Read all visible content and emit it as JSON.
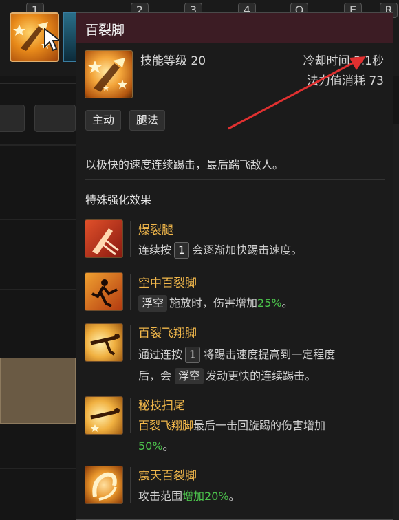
{
  "hotbar": {
    "keys": [
      "1",
      "2",
      "3",
      "4",
      "Q",
      "E",
      "R"
    ]
  },
  "tooltip": {
    "title": "百裂脚",
    "skill_level": "技能等级 20",
    "cooldown": "冷却时间 3.1秒",
    "mana_cost": "法力值消耗 73",
    "tags": [
      "主动",
      "腿法"
    ],
    "description": "以极快的速度连续踢击，最后踹飞敌人。",
    "special_title": "特殊强化效果",
    "effects": [
      {
        "name": "爆裂腿",
        "line1_pre": "连续按",
        "line1_key": "1",
        "line1_post": "会逐渐加快踢击速度。"
      },
      {
        "name": "空中百裂脚",
        "line1_chip": "浮空",
        "line1_mid": "施放时，伤害增加",
        "line1_value": "25%",
        "line1_end": "。"
      },
      {
        "name": "百裂飞翔脚",
        "line1_pre": "通过连按",
        "line1_key": "1",
        "line1_post": "将踢击速度提高到一定程度",
        "line2_pre": "后，会",
        "line2_chip": "浮空",
        "line2_post": "发动更快的连续踢击。"
      },
      {
        "name": "秘技扫尾",
        "line1_highlight": "百裂飞翔脚",
        "line1_post": "最后一击回旋踢的伤害增加",
        "line2_value": "50%",
        "line2_end": "。"
      },
      {
        "name": "震天百裂脚",
        "line1_pre": "攻击范围",
        "line1_value": "增加20%",
        "line1_end": "。"
      }
    ]
  },
  "colors": {
    "header_bg": "#3c1c24",
    "effect_name": "#f2b84b",
    "value_green": "#4cc44c",
    "annotation_arrow": "#e03030"
  },
  "icons": [
    "mouse-cursor-icon",
    "kick-skill-icon",
    "leg-blast-icon",
    "air-kick-icon",
    "flying-kick-icon",
    "sweep-tail-icon",
    "quake-kick-icon"
  ]
}
